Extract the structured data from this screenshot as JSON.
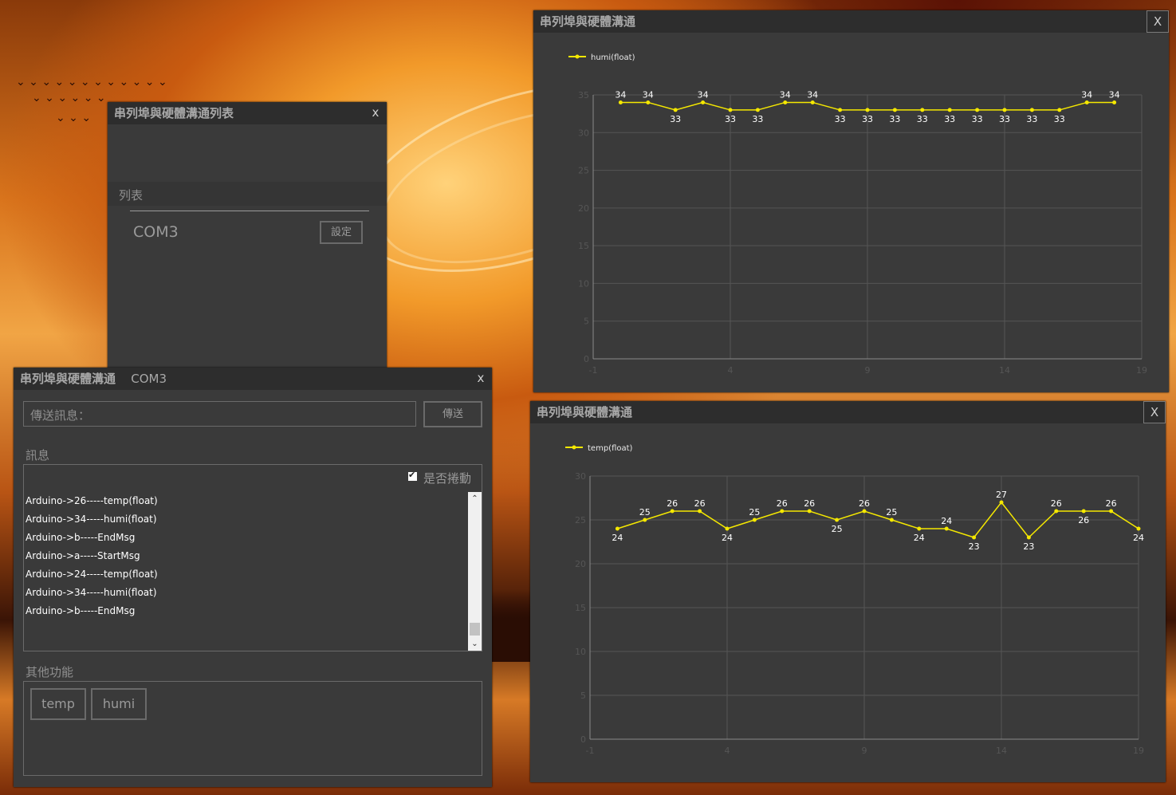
{
  "port_list_window": {
    "title": "串列埠與硬體溝通列表",
    "close": "x",
    "section_label": "列表",
    "ports": [
      {
        "name": "COM3",
        "button": "設定"
      }
    ]
  },
  "comm_window": {
    "title": "串列埠與硬體溝通",
    "port": "COM3",
    "close": "x",
    "send_placeholder": "傳送訊息：",
    "send_button": "傳送",
    "messages_label": "訊息",
    "autoscroll_label": "是否捲動",
    "autoscroll_checked": true,
    "messages": [
      "Arduino->26-----temp(float)",
      "Arduino->34-----humi(float)",
      "Arduino->b-----EndMsg",
      "Arduino->a-----StartMsg",
      "Arduino->24-----temp(float)",
      "Arduino->34-----humi(float)",
      "Arduino->b-----EndMsg"
    ],
    "other_label": "其他功能",
    "function_buttons": [
      "temp",
      "humi"
    ]
  },
  "chart_window_humi": {
    "title": "串列埠與硬體溝通",
    "close": "X"
  },
  "chart_window_temp": {
    "title": "串列埠與硬體溝通",
    "close": "X"
  },
  "colors": {
    "series": "#f5e800",
    "window_bg": "#3a3a3a",
    "titlebar_bg": "#2d2d2d"
  },
  "chart_data": [
    {
      "type": "line",
      "series": [
        {
          "name": "humi(float)",
          "values": [
            34,
            34,
            33,
            34,
            33,
            33,
            34,
            34,
            33,
            33,
            33,
            33,
            33,
            33,
            33,
            33,
            33,
            34,
            34
          ]
        }
      ],
      "x": [
        0,
        1,
        2,
        3,
        4,
        5,
        6,
        7,
        8,
        9,
        10,
        11,
        12,
        13,
        14,
        15,
        16,
        17,
        18
      ],
      "xticks": [
        "-1",
        "4",
        "9",
        "14",
        "19"
      ],
      "yticks": [
        "0",
        "5",
        "10",
        "15",
        "20",
        "25",
        "30",
        "35"
      ],
      "xlim": [
        -1,
        19
      ],
      "ylim": [
        0,
        35
      ],
      "grid": true,
      "legend": "top-left"
    },
    {
      "type": "line",
      "series": [
        {
          "name": "temp(float)",
          "values": [
            24,
            25,
            26,
            26,
            24,
            25,
            26,
            26,
            25,
            26,
            25,
            24,
            24,
            23,
            27,
            23,
            26,
            26,
            26,
            24
          ]
        }
      ],
      "x": [
        0,
        1,
        2,
        3,
        4,
        5,
        6,
        7,
        8,
        9,
        10,
        11,
        12,
        13,
        14,
        15,
        16,
        17,
        18,
        19
      ],
      "xticks": [
        "-1",
        "4",
        "9",
        "14",
        "19"
      ],
      "yticks": [
        "0",
        "5",
        "10",
        "15",
        "20",
        "25",
        "30"
      ],
      "xlim": [
        -1,
        19
      ],
      "ylim": [
        0,
        30
      ],
      "grid": true,
      "legend": "top-left"
    }
  ]
}
